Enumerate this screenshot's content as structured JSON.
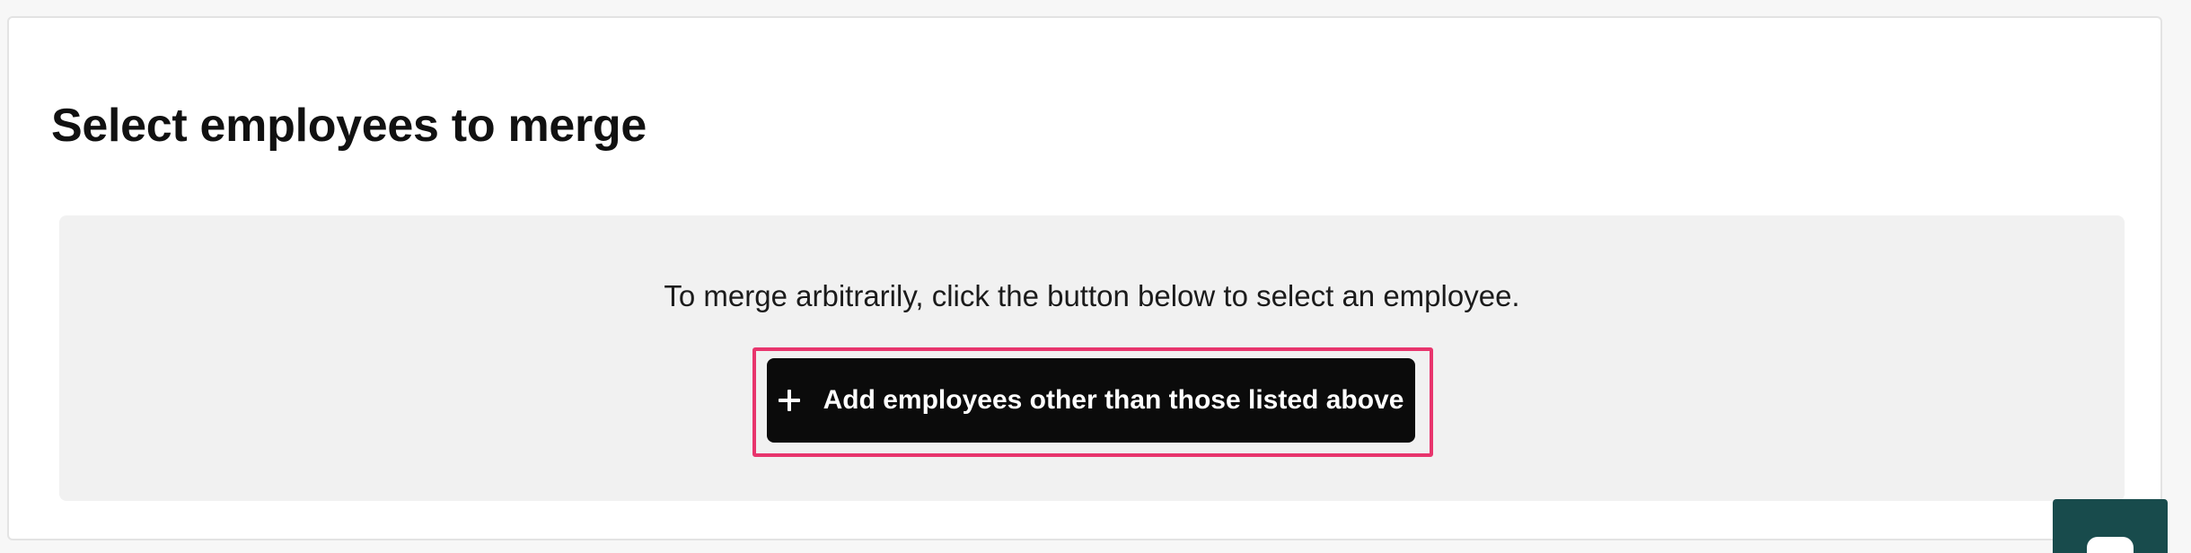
{
  "section": {
    "title": "Select employees to merge"
  },
  "merge_panel": {
    "instruction": "To merge arbitrarily, click the button below to select an employee.",
    "add_button_label": "Add employees other than those listed above",
    "add_button_icon": "plus-icon"
  },
  "chat_widget": {
    "icon": "chat-bubble-icon"
  },
  "colors": {
    "button_background": "#0b0b0b",
    "highlight_border": "#e8356d",
    "panel_background": "#f1f1f1",
    "chat_launcher": "#184b4c"
  }
}
